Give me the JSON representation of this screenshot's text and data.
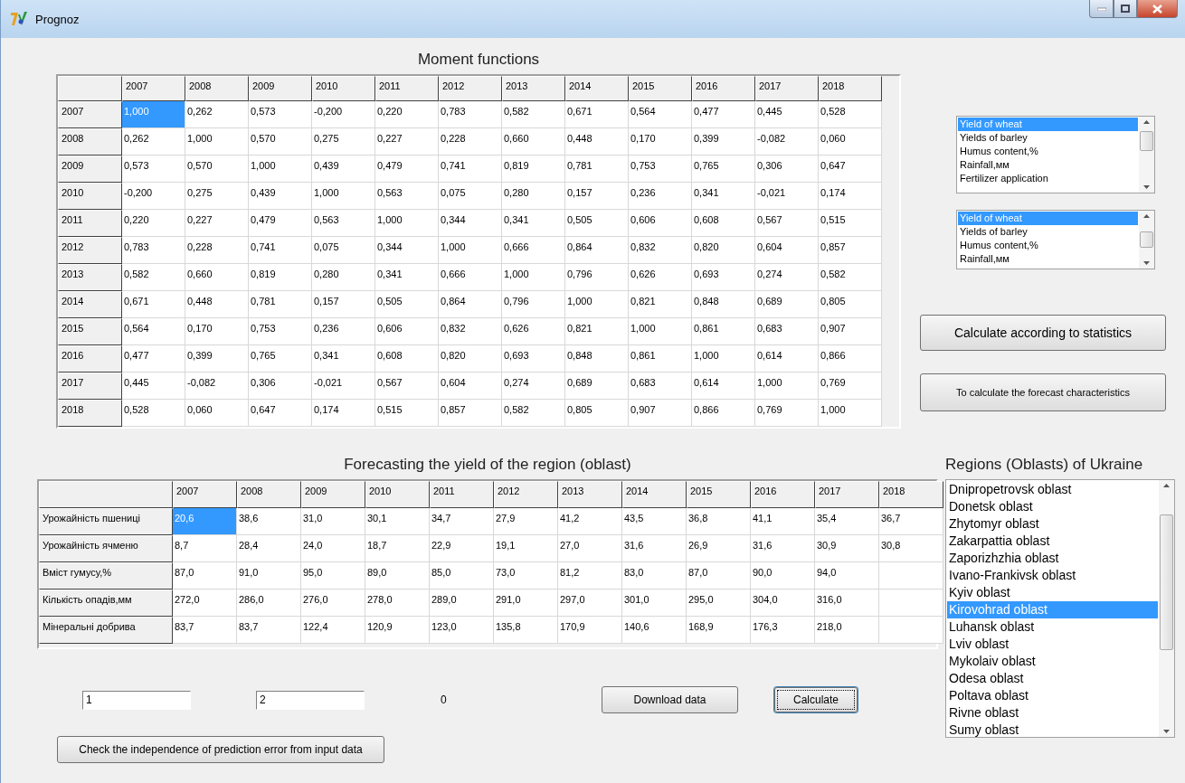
{
  "window": {
    "title": "Prognoz"
  },
  "moment_functions": {
    "title": "Moment functions",
    "columns": [
      "2007",
      "2008",
      "2009",
      "2010",
      "2011",
      "2012",
      "2013",
      "2014",
      "2015",
      "2016",
      "2017",
      "2018"
    ],
    "rows": [
      {
        "label": "2007",
        "cells": [
          {
            "text": "1,000",
            "selected": true
          },
          {
            "text": "0,262",
            "selected": false
          },
          {
            "text": "0,573",
            "selected": false
          },
          {
            "text": "-0,200",
            "selected": false
          },
          {
            "text": "0,220",
            "selected": false
          },
          {
            "text": "0,783",
            "selected": false
          },
          {
            "text": "0,582",
            "selected": false
          },
          {
            "text": "0,671",
            "selected": false
          },
          {
            "text": "0,564",
            "selected": false
          },
          {
            "text": "0,477",
            "selected": false
          },
          {
            "text": "0,445",
            "selected": false
          },
          {
            "text": "0,528",
            "selected": false
          }
        ]
      },
      {
        "label": "2008",
        "cells": [
          {
            "text": "0,262",
            "selected": false
          },
          {
            "text": "1,000",
            "selected": false
          },
          {
            "text": "0,570",
            "selected": false
          },
          {
            "text": "0,275",
            "selected": false
          },
          {
            "text": "0,227",
            "selected": false
          },
          {
            "text": "0,228",
            "selected": false
          },
          {
            "text": "0,660",
            "selected": false
          },
          {
            "text": "0,448",
            "selected": false
          },
          {
            "text": "0,170",
            "selected": false
          },
          {
            "text": "0,399",
            "selected": false
          },
          {
            "text": "-0,082",
            "selected": false
          },
          {
            "text": "0,060",
            "selected": false
          }
        ]
      },
      {
        "label": "2009",
        "cells": [
          {
            "text": "0,573",
            "selected": false
          },
          {
            "text": "0,570",
            "selected": false
          },
          {
            "text": "1,000",
            "selected": false
          },
          {
            "text": "0,439",
            "selected": false
          },
          {
            "text": "0,479",
            "selected": false
          },
          {
            "text": "0,741",
            "selected": false
          },
          {
            "text": "0,819",
            "selected": false
          },
          {
            "text": "0,781",
            "selected": false
          },
          {
            "text": "0,753",
            "selected": false
          },
          {
            "text": "0,765",
            "selected": false
          },
          {
            "text": "0,306",
            "selected": false
          },
          {
            "text": "0,647",
            "selected": false
          }
        ]
      },
      {
        "label": "2010",
        "cells": [
          {
            "text": "-0,200",
            "selected": false
          },
          {
            "text": "0,275",
            "selected": false
          },
          {
            "text": "0,439",
            "selected": false
          },
          {
            "text": "1,000",
            "selected": false
          },
          {
            "text": "0,563",
            "selected": false
          },
          {
            "text": "0,075",
            "selected": false
          },
          {
            "text": "0,280",
            "selected": false
          },
          {
            "text": "0,157",
            "selected": false
          },
          {
            "text": "0,236",
            "selected": false
          },
          {
            "text": "0,341",
            "selected": false
          },
          {
            "text": "-0,021",
            "selected": false
          },
          {
            "text": "0,174",
            "selected": false
          }
        ]
      },
      {
        "label": "2011",
        "cells": [
          {
            "text": "0,220",
            "selected": false
          },
          {
            "text": "0,227",
            "selected": false
          },
          {
            "text": "0,479",
            "selected": false
          },
          {
            "text": "0,563",
            "selected": false
          },
          {
            "text": "1,000",
            "selected": false
          },
          {
            "text": "0,344",
            "selected": false
          },
          {
            "text": "0,341",
            "selected": false
          },
          {
            "text": "0,505",
            "selected": false
          },
          {
            "text": "0,606",
            "selected": false
          },
          {
            "text": "0,608",
            "selected": false
          },
          {
            "text": "0,567",
            "selected": false
          },
          {
            "text": "0,515",
            "selected": false
          }
        ]
      },
      {
        "label": "2012",
        "cells": [
          {
            "text": "0,783",
            "selected": false
          },
          {
            "text": "0,228",
            "selected": false
          },
          {
            "text": "0,741",
            "selected": false
          },
          {
            "text": "0,075",
            "selected": false
          },
          {
            "text": "0,344",
            "selected": false
          },
          {
            "text": "1,000",
            "selected": false
          },
          {
            "text": "0,666",
            "selected": false
          },
          {
            "text": "0,864",
            "selected": false
          },
          {
            "text": "0,832",
            "selected": false
          },
          {
            "text": "0,820",
            "selected": false
          },
          {
            "text": "0,604",
            "selected": false
          },
          {
            "text": "0,857",
            "selected": false
          }
        ]
      },
      {
        "label": "2013",
        "cells": [
          {
            "text": "0,582",
            "selected": false
          },
          {
            "text": "0,660",
            "selected": false
          },
          {
            "text": "0,819",
            "selected": false
          },
          {
            "text": "0,280",
            "selected": false
          },
          {
            "text": "0,341",
            "selected": false
          },
          {
            "text": "0,666",
            "selected": false
          },
          {
            "text": "1,000",
            "selected": false
          },
          {
            "text": "0,796",
            "selected": false
          },
          {
            "text": "0,626",
            "selected": false
          },
          {
            "text": "0,693",
            "selected": false
          },
          {
            "text": "0,274",
            "selected": false
          },
          {
            "text": "0,582",
            "selected": false
          }
        ]
      },
      {
        "label": "2014",
        "cells": [
          {
            "text": "0,671",
            "selected": false
          },
          {
            "text": "0,448",
            "selected": false
          },
          {
            "text": "0,781",
            "selected": false
          },
          {
            "text": "0,157",
            "selected": false
          },
          {
            "text": "0,505",
            "selected": false
          },
          {
            "text": "0,864",
            "selected": false
          },
          {
            "text": "0,796",
            "selected": false
          },
          {
            "text": "1,000",
            "selected": false
          },
          {
            "text": "0,821",
            "selected": false
          },
          {
            "text": "0,848",
            "selected": false
          },
          {
            "text": "0,689",
            "selected": false
          },
          {
            "text": "0,805",
            "selected": false
          }
        ]
      },
      {
        "label": "2015",
        "cells": [
          {
            "text": "0,564",
            "selected": false
          },
          {
            "text": "0,170",
            "selected": false
          },
          {
            "text": "0,753",
            "selected": false
          },
          {
            "text": "0,236",
            "selected": false
          },
          {
            "text": "0,606",
            "selected": false
          },
          {
            "text": "0,832",
            "selected": false
          },
          {
            "text": "0,626",
            "selected": false
          },
          {
            "text": "0,821",
            "selected": false
          },
          {
            "text": "1,000",
            "selected": false
          },
          {
            "text": "0,861",
            "selected": false
          },
          {
            "text": "0,683",
            "selected": false
          },
          {
            "text": "0,907",
            "selected": false
          }
        ]
      },
      {
        "label": "2016",
        "cells": [
          {
            "text": "0,477",
            "selected": false
          },
          {
            "text": "0,399",
            "selected": false
          },
          {
            "text": "0,765",
            "selected": false
          },
          {
            "text": "0,341",
            "selected": false
          },
          {
            "text": "0,608",
            "selected": false
          },
          {
            "text": "0,820",
            "selected": false
          },
          {
            "text": "0,693",
            "selected": false
          },
          {
            "text": "0,848",
            "selected": false
          },
          {
            "text": "0,861",
            "selected": false
          },
          {
            "text": "1,000",
            "selected": false
          },
          {
            "text": "0,614",
            "selected": false
          },
          {
            "text": "0,866",
            "selected": false
          }
        ]
      },
      {
        "label": "2017",
        "cells": [
          {
            "text": "0,445",
            "selected": false
          },
          {
            "text": "-0,082",
            "selected": false
          },
          {
            "text": "0,306",
            "selected": false
          },
          {
            "text": "-0,021",
            "selected": false
          },
          {
            "text": "0,567",
            "selected": false
          },
          {
            "text": "0,604",
            "selected": false
          },
          {
            "text": "0,274",
            "selected": false
          },
          {
            "text": "0,689",
            "selected": false
          },
          {
            "text": "0,683",
            "selected": false
          },
          {
            "text": "0,614",
            "selected": false
          },
          {
            "text": "1,000",
            "selected": false
          },
          {
            "text": "0,769",
            "selected": false
          }
        ]
      },
      {
        "label": "2018",
        "cells": [
          {
            "text": "0,528",
            "selected": false
          },
          {
            "text": "0,060",
            "selected": false
          },
          {
            "text": "0,647",
            "selected": false
          },
          {
            "text": "0,174",
            "selected": false
          },
          {
            "text": "0,515",
            "selected": false
          },
          {
            "text": "0,857",
            "selected": false
          },
          {
            "text": "0,582",
            "selected": false
          },
          {
            "text": "0,805",
            "selected": false
          },
          {
            "text": "0,907",
            "selected": false
          },
          {
            "text": "0,866",
            "selected": false
          },
          {
            "text": "0,769",
            "selected": false
          },
          {
            "text": "1,000",
            "selected": false
          }
        ]
      }
    ]
  },
  "factor_lists": [
    {
      "items": [
        {
          "label": "Yield of wheat",
          "selected": true
        },
        {
          "label": "Yields of barley",
          "selected": false
        },
        {
          "label": "Humus content,%",
          "selected": false
        },
        {
          "label": "Rainfall,мм",
          "selected": false
        },
        {
          "label": "Fertilizer application",
          "selected": false
        }
      ]
    },
    {
      "items": [
        {
          "label": "Yield of wheat",
          "selected": true
        },
        {
          "label": "Yields of barley",
          "selected": false
        },
        {
          "label": "Humus content,%",
          "selected": false
        },
        {
          "label": "Rainfall,мм",
          "selected": false
        }
      ]
    }
  ],
  "side_buttons": [
    "Calculate according to statistics",
    "To calculate the forecast characteristics"
  ],
  "forecast": {
    "title": "Forecasting the yield of the region (oblast)",
    "columns": [
      "2007",
      "2008",
      "2009",
      "2010",
      "2011",
      "2012",
      "2013",
      "2014",
      "2015",
      "2016",
      "2017",
      "2018"
    ],
    "rows": [
      {
        "label": "Урожайність пшениці",
        "cells": [
          {
            "text": "20,6",
            "selected": true
          },
          {
            "text": "38,6",
            "selected": false
          },
          {
            "text": "31,0",
            "selected": false
          },
          {
            "text": "30,1",
            "selected": false
          },
          {
            "text": "34,7",
            "selected": false
          },
          {
            "text": "27,9",
            "selected": false
          },
          {
            "text": "41,2",
            "selected": false
          },
          {
            "text": "43,5",
            "selected": false
          },
          {
            "text": "36,8",
            "selected": false
          },
          {
            "text": "41,1",
            "selected": false
          },
          {
            "text": "35,4",
            "selected": false
          },
          {
            "text": "36,7",
            "selected": false
          }
        ]
      },
      {
        "label": "Урожайність ячменю",
        "cells": [
          {
            "text": "8,7",
            "selected": false
          },
          {
            "text": "28,4",
            "selected": false
          },
          {
            "text": "24,0",
            "selected": false
          },
          {
            "text": "18,7",
            "selected": false
          },
          {
            "text": "22,9",
            "selected": false
          },
          {
            "text": "19,1",
            "selected": false
          },
          {
            "text": "27,0",
            "selected": false
          },
          {
            "text": "31,6",
            "selected": false
          },
          {
            "text": "26,9",
            "selected": false
          },
          {
            "text": "31,6",
            "selected": false
          },
          {
            "text": "30,9",
            "selected": false
          },
          {
            "text": "30,8",
            "selected": false
          }
        ]
      },
      {
        "label": "Вміст гумусу,%",
        "cells": [
          {
            "text": "87,0",
            "selected": false
          },
          {
            "text": "91,0",
            "selected": false
          },
          {
            "text": "95,0",
            "selected": false
          },
          {
            "text": "89,0",
            "selected": false
          },
          {
            "text": "85,0",
            "selected": false
          },
          {
            "text": "73,0",
            "selected": false
          },
          {
            "text": "81,2",
            "selected": false
          },
          {
            "text": "83,0",
            "selected": false
          },
          {
            "text": "87,0",
            "selected": false
          },
          {
            "text": "90,0",
            "selected": false
          },
          {
            "text": "94,0",
            "selected": false
          },
          {
            "text": "",
            "selected": false
          }
        ]
      },
      {
        "label": "Кількість опадів,мм",
        "cells": [
          {
            "text": "272,0",
            "selected": false
          },
          {
            "text": "286,0",
            "selected": false
          },
          {
            "text": "276,0",
            "selected": false
          },
          {
            "text": "278,0",
            "selected": false
          },
          {
            "text": "289,0",
            "selected": false
          },
          {
            "text": "291,0",
            "selected": false
          },
          {
            "text": "297,0",
            "selected": false
          },
          {
            "text": "301,0",
            "selected": false
          },
          {
            "text": "295,0",
            "selected": false
          },
          {
            "text": "304,0",
            "selected": false
          },
          {
            "text": "316,0",
            "selected": false
          },
          {
            "text": "",
            "selected": false
          }
        ]
      },
      {
        "label": "Мінеральні добрива",
        "cells": [
          {
            "text": "83,7",
            "selected": false
          },
          {
            "text": "83,7",
            "selected": false
          },
          {
            "text": "122,4",
            "selected": false
          },
          {
            "text": "120,9",
            "selected": false
          },
          {
            "text": "123,0",
            "selected": false
          },
          {
            "text": "135,8",
            "selected": false
          },
          {
            "text": "170,9",
            "selected": false
          },
          {
            "text": "140,6",
            "selected": false
          },
          {
            "text": "168,9",
            "selected": false
          },
          {
            "text": "176,3",
            "selected": false
          },
          {
            "text": "218,0",
            "selected": false
          },
          {
            "text": "",
            "selected": false
          }
        ]
      }
    ]
  },
  "inputs": [
    {
      "value": "1"
    },
    {
      "value": "2"
    }
  ],
  "result": "0",
  "download_button": "Download data",
  "calculate_button": {
    "label": "Calculate",
    "focused": true
  },
  "check_button": "Check the independence of prediction error from input data",
  "regions": {
    "title": "Regions (Oblasts) of Ukraine",
    "items": [
      {
        "label": "Dnipropetrovsk oblast",
        "selected": false
      },
      {
        "label": "Donetsk oblast",
        "selected": false
      },
      {
        "label": "Zhytomyr oblast",
        "selected": false
      },
      {
        "label": "Zakarpattia oblast",
        "selected": false
      },
      {
        "label": "Zaporizhzhia oblast",
        "selected": false
      },
      {
        "label": "Ivano-Frankivsk oblast",
        "selected": false
      },
      {
        "label": "Kyiv oblast",
        "selected": false
      },
      {
        "label": "Kirovohrad oblast",
        "selected": true
      },
      {
        "label": "Luhansk oblast",
        "selected": false
      },
      {
        "label": "Lviv oblast",
        "selected": false
      },
      {
        "label": "Mykolaiv oblast",
        "selected": false
      },
      {
        "label": "Odesa oblast",
        "selected": false
      },
      {
        "label": "Poltava oblast",
        "selected": false
      },
      {
        "label": "Rivne oblast",
        "selected": false
      },
      {
        "label": "Sumy oblast",
        "selected": false
      }
    ]
  }
}
